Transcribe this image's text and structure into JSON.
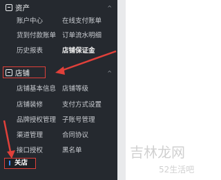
{
  "sidebar": {
    "assets": {
      "title": "资产",
      "items": [
        "账户中心",
        "在线支付账单",
        "货到付款账单",
        "订单流水明细",
        "历史报表",
        "店铺保证金"
      ]
    },
    "store": {
      "title": "店铺",
      "items": [
        "店铺基本信息",
        "店铺等级",
        "店铺装修",
        "支付方式设置",
        "品牌授权管理",
        "子账号管理",
        "渠道管理",
        "合同协议",
        "接口授权",
        "黑名单"
      ]
    },
    "close_button": "关店"
  },
  "watermark": {
    "line1": "吉林龙网",
    "line2": "52生活吧"
  },
  "colors": {
    "sidebar_bg": "#25292f",
    "highlight_red": "#e0403a",
    "accent_blue": "#3a8bff"
  }
}
